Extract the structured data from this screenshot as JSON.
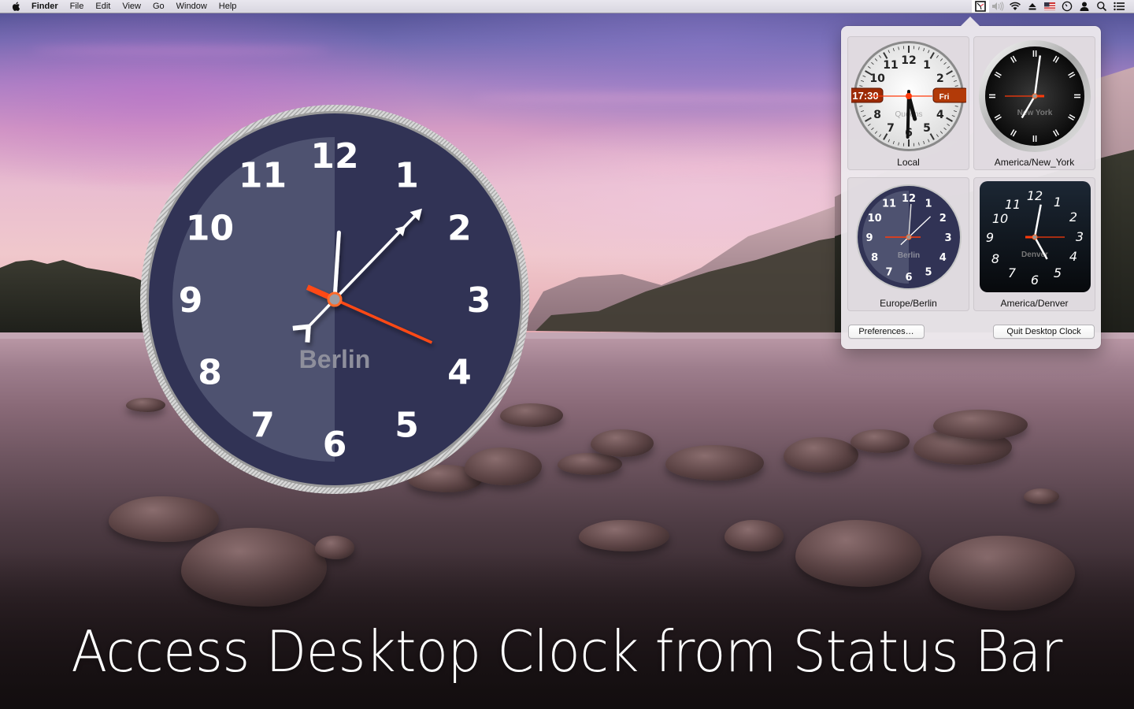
{
  "menubar": {
    "app_menu": "Finder",
    "menus": [
      "File",
      "Edit",
      "View",
      "Go",
      "Window",
      "Help"
    ],
    "status_icons": [
      "desktop-clock-icon",
      "volume-icon",
      "wifi-icon",
      "eject-icon",
      "us-flag-icon",
      "time-machine-icon",
      "user-icon",
      "spotlight-search-icon",
      "notification-center-icon"
    ]
  },
  "desktop_clock": {
    "city_label": "Berlin",
    "numerals": [
      "12",
      "1",
      "2",
      "3",
      "4",
      "5",
      "6",
      "7",
      "8",
      "9",
      "10",
      "11"
    ],
    "time": {
      "hours": 12,
      "minutes": 7,
      "seconds": 19
    },
    "colors": {
      "face": "#313355",
      "face_light": "#4e5270",
      "second_hand": "#ff4a12",
      "bezel": "#c9c9c9"
    }
  },
  "popover": {
    "clocks": [
      {
        "caption": "Local",
        "face_label": "Queens",
        "digital_time": "17:30",
        "day": "Fri",
        "style": "classic-white",
        "time": {
          "hours": 5,
          "minutes": 30,
          "seconds": 15
        }
      },
      {
        "caption": "America/New_York",
        "face_label": "New York",
        "style": "black-bars",
        "time": {
          "hours": 7,
          "minutes": 1,
          "seconds": 15
        }
      },
      {
        "caption": "Europe/Berlin",
        "face_label": "Berlin",
        "style": "navy-split",
        "time": {
          "hours": 12,
          "minutes": 7,
          "seconds": 45
        }
      },
      {
        "caption": "America/Denver",
        "face_label": "Denver",
        "style": "dark-square",
        "time": {
          "hours": 5,
          "minutes": 1,
          "seconds": 45
        }
      }
    ],
    "preferences_label": "Preferences…",
    "quit_label": "Quit Desktop Clock"
  },
  "caption": "Access Desktop Clock from Status Bar"
}
